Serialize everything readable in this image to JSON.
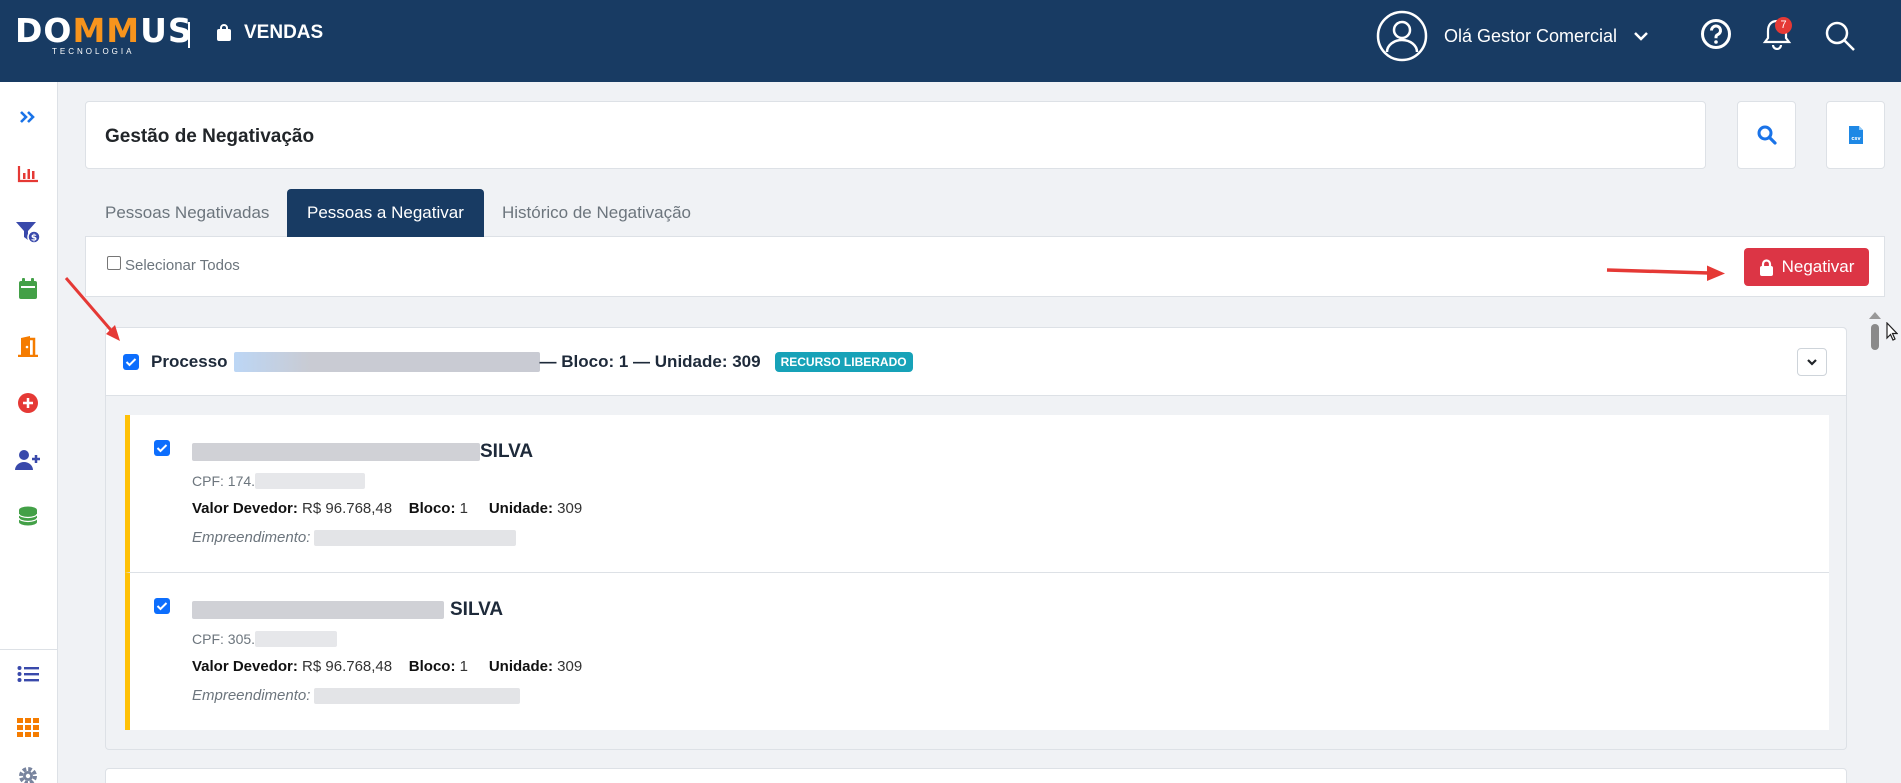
{
  "topbar": {
    "logo_pre": "DO",
    "logo_mm": "MM",
    "logo_post": "US",
    "logo_sub": "TECNOLOGIA",
    "module": "VENDAS",
    "greeting": "Olá Gestor Comercial",
    "notifications_count": "7",
    "icons": [
      "bag-icon",
      "user-avatar-icon",
      "chevron-down-icon",
      "help-icon",
      "bell-icon",
      "search-icon"
    ]
  },
  "sidebar": {
    "icons": [
      "expand-icon",
      "chart-icon",
      "funnel-money-icon",
      "calendar-icon",
      "door-icon",
      "plus-circle-icon",
      "user-plus-icon",
      "coins-icon",
      "list-icon",
      "grid-icon",
      "gear-icon"
    ]
  },
  "header": {
    "title": "Gestão de Negativação"
  },
  "tabs": [
    {
      "label": "Pessoas Negativadas"
    },
    {
      "label": "Pessoas a Negativar",
      "active": true
    },
    {
      "label": "Histórico de Negativação"
    }
  ],
  "toolbar": {
    "select_all_label": "Selecionar Todos",
    "negativar_label": "Negativar"
  },
  "process": {
    "prefix": "Processo",
    "suffix": "— Bloco: 1 — Unidade: 309",
    "badge": "RECURSO LIBERADO",
    "people": [
      {
        "name_suffix": "SILVA",
        "cpf": "CPF: 174.",
        "valor_label": "Valor Devedor:",
        "valor": "R$ 96.768,48",
        "bloco_label": "Bloco:",
        "bloco": "1",
        "unidade_label": "Unidade:",
        "unidade": "309",
        "emp_label": "Empreendimento:"
      },
      {
        "name_suffix": "SILVA",
        "cpf": "CPF: 305.",
        "valor_label": "Valor Devedor:",
        "valor": "R$ 96.768,48",
        "bloco_label": "Bloco:",
        "bloco": "1",
        "unidade_label": "Unidade:",
        "unidade": "309",
        "emp_label": "Empreendimento:"
      }
    ]
  },
  "colors": {
    "topbar": "#183b63",
    "accent_orange": "#f7941d",
    "danger": "#dc3545",
    "badge": "#17a2b8",
    "warning_border": "#ffc107",
    "checkbox": "#0d6efd"
  }
}
